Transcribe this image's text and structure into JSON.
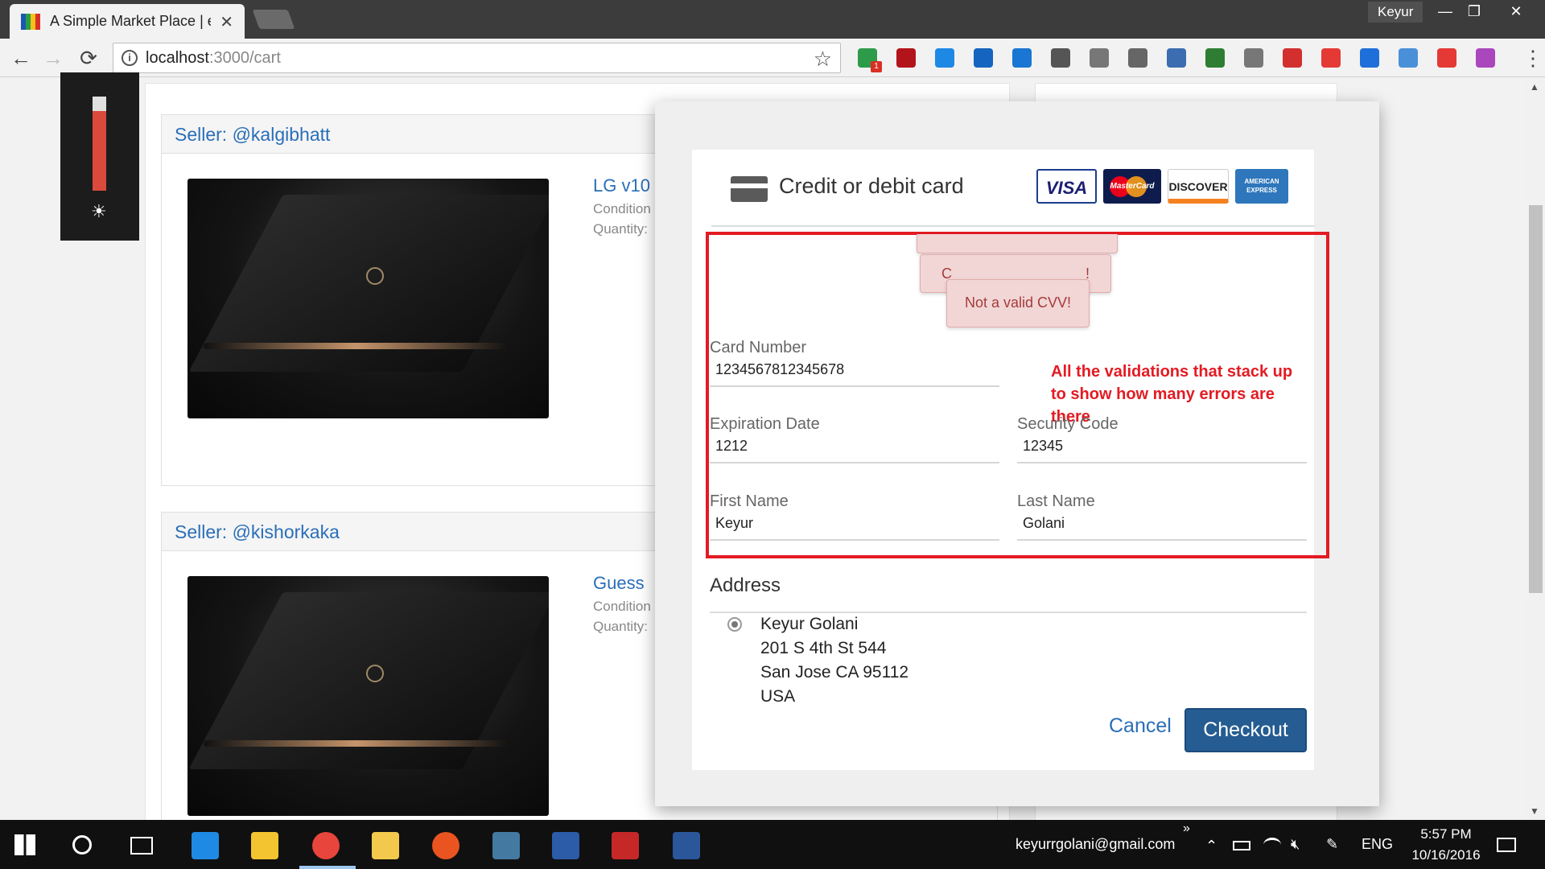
{
  "browser": {
    "tab_title": "A Simple Market Place | e",
    "tab_close": "✕",
    "profile_name": "Keyur",
    "window_controls": {
      "minimize": "—",
      "restore": "❐",
      "close": "✕"
    },
    "nav": {
      "back": "←",
      "forward": "→",
      "reload": "⟳"
    },
    "url_host": "localhost",
    "url_path": ":3000/cart",
    "info_icon": "i",
    "star_icon": "☆",
    "extensions": [
      {
        "name": "extension-badge-icon",
        "color": "#2e9b4b"
      },
      {
        "name": "acrobat-icon",
        "color": "#b3131b"
      },
      {
        "name": "layers-icon",
        "color": "#1e88e5"
      },
      {
        "name": "shape-icon",
        "color": "#1565c0"
      },
      {
        "name": "megaphone-icon",
        "color": "#1976d2"
      },
      {
        "name": "pen-icon",
        "color": "#555555"
      },
      {
        "name": "angular-icon",
        "color": "#777777"
      },
      {
        "name": "font-icon",
        "color": "#666666"
      },
      {
        "name": "window-icon",
        "color": "#3b6db0"
      },
      {
        "name": "bw-icon",
        "color": "#2e7d32"
      },
      {
        "name": "shield-icon",
        "color": "#777777"
      },
      {
        "name": "bookmark-icon",
        "color": "#d32f2f"
      },
      {
        "name": "abp-icon",
        "color": "#e53935"
      },
      {
        "name": "bookmark-manager-icon",
        "color": "#1e6fd9"
      },
      {
        "name": "toggle-icon",
        "color": "#4a90d9"
      },
      {
        "name": "star-badge-icon",
        "color": "#e53935"
      },
      {
        "name": "color-wheel-icon",
        "color": "#ab47bc"
      }
    ],
    "ext_badge": "1",
    "menu": "⋮"
  },
  "page": {
    "sellers": [
      {
        "label": "Seller: @kalgibhatt",
        "product_title": "LG v10",
        "condition": "Condition",
        "quantity": "Quantity:"
      },
      {
        "label": "Seller: @kishorkaka",
        "product_title": "Guess",
        "condition": "Condition",
        "quantity": "Quantity:"
      }
    ],
    "scroll_up": "▲",
    "scroll_down": "▼"
  },
  "brightness": {
    "level": 0.85,
    "icon": "☀"
  },
  "modal": {
    "card_title": "Credit or debit card",
    "brands": [
      "VISA",
      "MasterCard",
      "DISCOVER",
      "AMERICAN EXPRESS"
    ],
    "toasts": [
      "",
      "C",
      "!",
      "Not a valid CVV!"
    ],
    "annotation": "All the validations that stack up to show how many errors are there",
    "fields": {
      "card_number": {
        "label": "Card Number",
        "value": "1234567812345678"
      },
      "expiration": {
        "label": "Expiration Date",
        "value": "1212"
      },
      "security": {
        "label": "Security Code",
        "value": "12345"
      },
      "first_name": {
        "label": "First Name",
        "value": "Keyur"
      },
      "last_name": {
        "label": "Last Name",
        "value": "Golani"
      }
    },
    "address_heading": "Address",
    "address": [
      "Keyur Golani",
      "201 S 4th St 544",
      "San Jose CA 95112",
      "USA"
    ],
    "cancel": "Cancel",
    "checkout": "Checkout"
  },
  "taskbar": {
    "email": "keyurrgolani@gmail.com",
    "chevron": "»",
    "tray_up": "⌃",
    "language": "ENG",
    "time": "5:57 PM",
    "date": "10/16/2016",
    "icons": [
      "windows-start-icon",
      "cortana-icon",
      "task-view-icon",
      "edge-icon",
      "file-explorer-icon",
      "chrome-icon",
      "paint-icon",
      "ubuntu-icon",
      "mysql-workbench-icon",
      "powershell-icon",
      "acrobat-icon",
      "word-icon"
    ]
  }
}
